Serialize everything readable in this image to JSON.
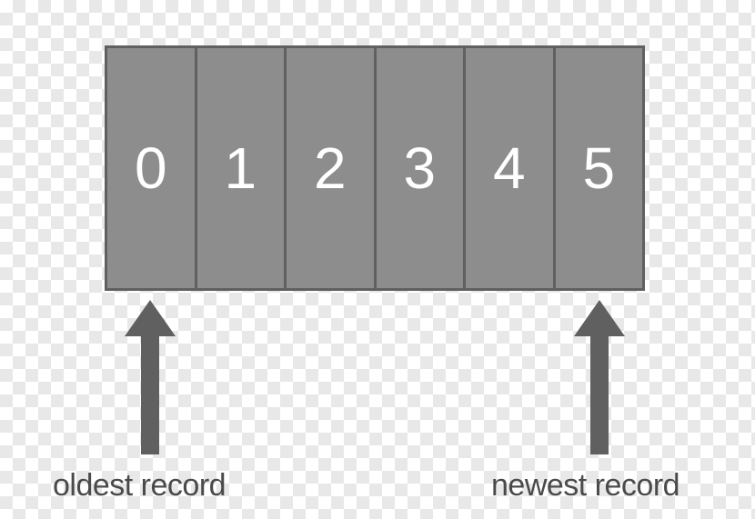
{
  "buffer": {
    "cells": [
      "0",
      "1",
      "2",
      "3",
      "4",
      "5"
    ]
  },
  "labels": {
    "oldest": "oldest record",
    "newest": "newest record"
  },
  "colors": {
    "cell_fill": "#8d8d8d",
    "border": "#606060",
    "arrow": "#606060",
    "text_light": "#ffffff",
    "text_dark": "#4a4a4a"
  }
}
